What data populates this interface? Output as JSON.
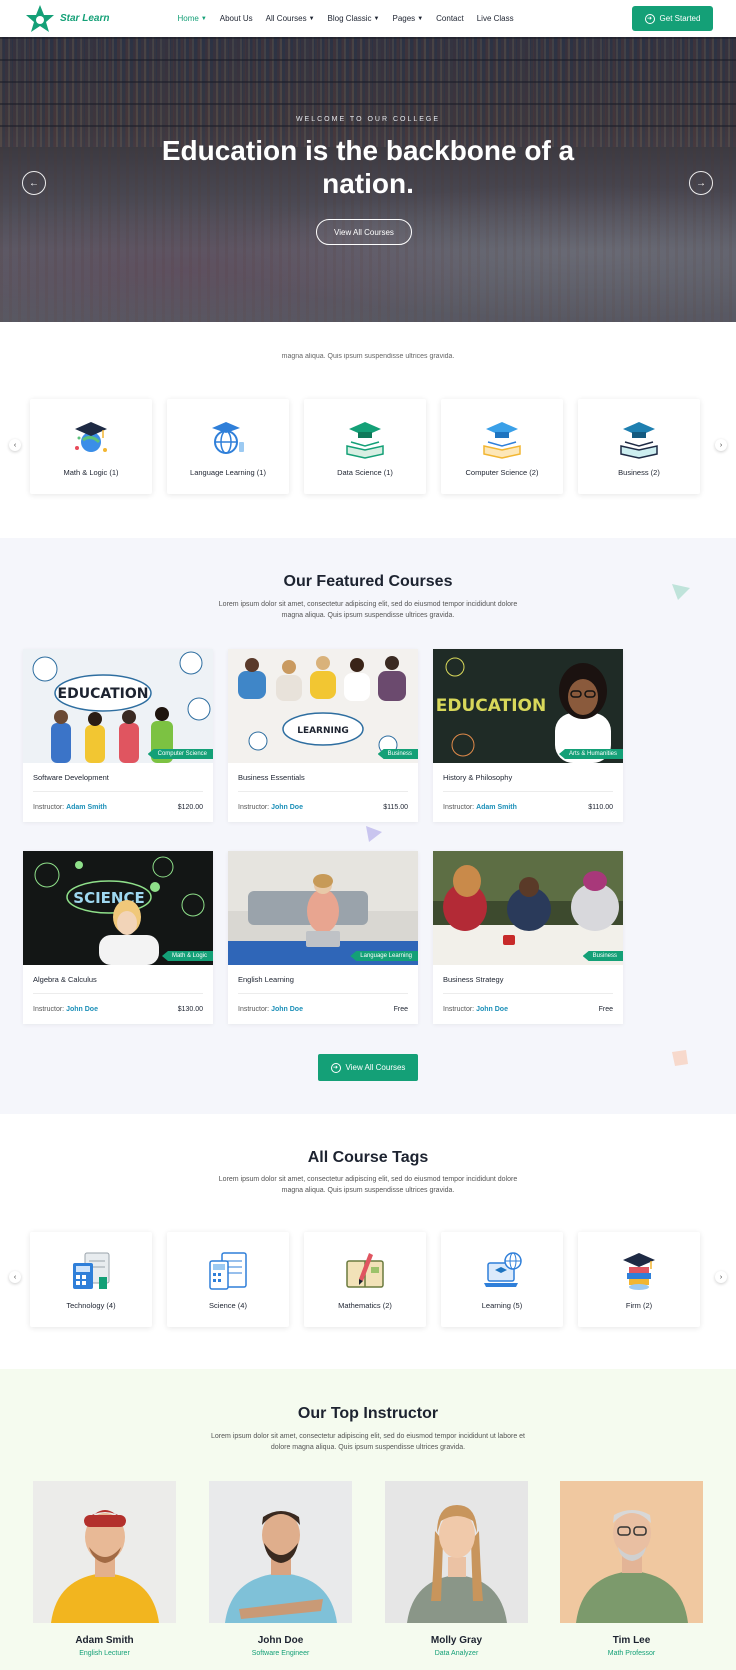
{
  "brand": {
    "name": "Star Learn",
    "accent": "#14a077",
    "link": "#1b8fb8"
  },
  "nav": {
    "items": [
      {
        "label": "Home",
        "caret": true,
        "active": true
      },
      {
        "label": "About Us",
        "caret": false
      },
      {
        "label": "All Courses",
        "caret": true
      },
      {
        "label": "Blog Classic",
        "caret": true
      },
      {
        "label": "Pages",
        "caret": true
      },
      {
        "label": "Contact",
        "caret": false
      },
      {
        "label": "Live Class",
        "caret": false
      }
    ],
    "cta_label": "Get Started"
  },
  "hero": {
    "kicker": "WELCOME TO OUR COLLEGE",
    "title": "Education is the backbone of a nation.",
    "button_label": "View All Courses"
  },
  "categories": {
    "subtitle": "magna aliqua. Quis ipsum suspendisse ultrices gravida.",
    "items": [
      {
        "label": "Math & Logic (1)",
        "icon": "graduation-globe-icon"
      },
      {
        "label": "Language Learning (1)",
        "icon": "globe-cap-icon"
      },
      {
        "label": "Data Science (1)",
        "icon": "book-cap-icon"
      },
      {
        "label": "Computer Science (2)",
        "icon": "book-cap-icon"
      },
      {
        "label": "Business (2)",
        "icon": "book-cap-icon"
      }
    ]
  },
  "featured": {
    "title": "Our Featured Courses",
    "subtitle_line1": "Lorem ipsum dolor sit amet, consectetur adipiscing elit, sed do eiusmod tempor incididunt dolore",
    "subtitle_line2": "magna aliqua. Quis ipsum suspendisse ultrices gravida.",
    "instructor_prefix": "Instructor:",
    "courses": [
      {
        "title": "Software Development",
        "tag": "Computer Science",
        "instructor": "Adam Smith",
        "price": "$120.00",
        "image": "education-board"
      },
      {
        "title": "Business Essentials",
        "tag": "Business",
        "instructor": "John Doe",
        "price": "$115.00",
        "image": "learning-students"
      },
      {
        "title": "History & Philosophy",
        "tag": "Arts & Humanities",
        "instructor": "Adam Smith",
        "price": "$110.00",
        "image": "chalkboard-girl"
      },
      {
        "title": "Algebra & Calculus",
        "tag": "Math & Logic",
        "instructor": "John Doe",
        "price": "$130.00",
        "image": "science-board"
      },
      {
        "title": "English Learning",
        "tag": "Language Learning",
        "instructor": "John Doe",
        "price": "Free",
        "image": "laptop-woman"
      },
      {
        "title": "Business Strategy",
        "tag": "Business",
        "instructor": "John Doe",
        "price": "Free",
        "image": "study-group"
      }
    ],
    "view_all_label": "View All Courses"
  },
  "tags": {
    "title": "All Course Tags",
    "subtitle_line1": "Lorem ipsum dolor sit amet, consectetur adipiscing elit, sed do eiusmod tempor incididunt dolore",
    "subtitle_line2": "magna aliqua. Quis ipsum suspendisse ultrices gravida.",
    "items": [
      {
        "label": "Technology (4)",
        "icon": "calculator-doc-icon"
      },
      {
        "label": "Science (4)",
        "icon": "calculator-sheet-icon"
      },
      {
        "label": "Mathematics (2)",
        "icon": "book-pencil-icon"
      },
      {
        "label": "Learning (5)",
        "icon": "laptop-globe-icon"
      },
      {
        "label": "Firm (2)",
        "icon": "cap-stack-icon"
      }
    ]
  },
  "instructors": {
    "title": "Our Top Instructor",
    "subtitle_line1": "Lorem ipsum dolor sit amet, consectetur adipiscing elit, sed do eiusmod tempor incididunt ut labore et",
    "subtitle_line2": "dolore magna aliqua. Quis ipsum suspendisse ultrices gravida.",
    "people": [
      {
        "name": "Adam Smith",
        "role": "English Lecturer"
      },
      {
        "name": "John Doe",
        "role": "Software Engineer"
      },
      {
        "name": "Molly Gray",
        "role": "Data Analyzer"
      },
      {
        "name": "Tim Lee",
        "role": "Math Professor"
      }
    ]
  }
}
